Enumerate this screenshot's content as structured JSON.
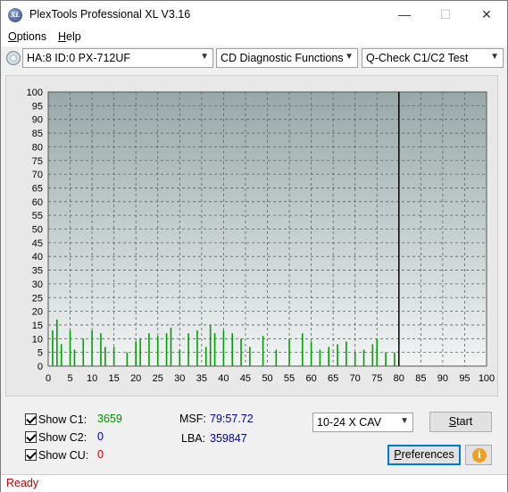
{
  "window": {
    "title": "PlexTools Professional XL V3.16",
    "icon_text": "XL"
  },
  "menu": [
    {
      "label": "Options",
      "key": "O",
      "rest": "ptions"
    },
    {
      "label": "Help",
      "key": "H",
      "rest": "elp"
    }
  ],
  "toolbar": {
    "drive": "HA:8 ID:0  PX-712UF",
    "function": "CD Diagnostic Functions",
    "test": "Q-Check C1/C2 Test"
  },
  "chart_data": {
    "type": "bar",
    "title": "",
    "xlabel": "",
    "ylabel": "",
    "xlim": [
      0,
      100
    ],
    "ylim": [
      0,
      100
    ],
    "x_ticks": [
      0,
      5,
      10,
      15,
      20,
      25,
      30,
      35,
      40,
      45,
      50,
      55,
      60,
      65,
      70,
      75,
      80,
      85,
      90,
      95,
      100
    ],
    "y_ticks": [
      0,
      5,
      10,
      15,
      20,
      25,
      30,
      35,
      40,
      45,
      50,
      55,
      60,
      65,
      70,
      75,
      80,
      85,
      90,
      95,
      100
    ],
    "grid": true,
    "test_end_x": 80,
    "series": [
      {
        "color": "#00a000",
        "x": [
          1,
          2,
          3,
          5,
          6,
          8,
          10,
          12,
          13,
          15,
          18,
          20,
          21,
          23,
          25,
          27,
          28,
          30,
          32,
          34,
          36,
          37,
          38,
          40,
          42,
          44,
          46,
          49,
          52,
          55,
          58,
          60,
          62,
          64,
          66,
          68,
          70,
          72,
          74,
          75,
          77,
          79
        ],
        "values": [
          13,
          17,
          8,
          13,
          6,
          10,
          13,
          12,
          7,
          7,
          5,
          9,
          10,
          12,
          11,
          12,
          14,
          6,
          12,
          13,
          7,
          15,
          12,
          13,
          12,
          10,
          7,
          11,
          6,
          10,
          12,
          9,
          6,
          7,
          8,
          9,
          5,
          6,
          8,
          10,
          5,
          5
        ]
      }
    ]
  },
  "stats": {
    "c1": {
      "label": "Show C1:",
      "value": "3659",
      "checked": true,
      "color": "#009000"
    },
    "c2": {
      "label": "Show C2:",
      "value": "0",
      "checked": true,
      "color": "#0000c0"
    },
    "cu": {
      "label": "Show CU:",
      "value": "0",
      "checked": true,
      "color": "#d00000"
    },
    "msf": {
      "label": "MSF:",
      "value": "79:57.72"
    },
    "lba": {
      "label": "LBA:",
      "value": "359847"
    }
  },
  "speed": "10-24 X CAV",
  "buttons": {
    "start": "Start",
    "start_key": "S",
    "start_rest": "tart",
    "preferences": "Preferences",
    "pref_key": "P",
    "pref_rest": "references",
    "info_icon": "info-icon"
  },
  "status": "Ready"
}
